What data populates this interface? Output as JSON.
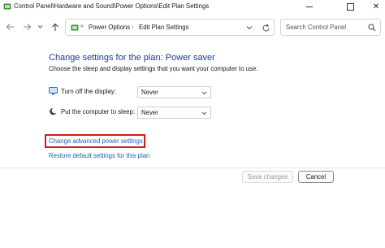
{
  "window": {
    "title": "Control Panel\\Hardware and Sound\\Power Options\\Edit Plan Settings",
    "controls": {
      "minimize_icon": "minimize-icon",
      "maximize_icon": "maximize-icon",
      "close_glyph": "✕"
    }
  },
  "address_bar": {
    "separator": "«",
    "crumbs": [
      "Power Options",
      "Edit Plan Settings"
    ],
    "crumb_separator": "›"
  },
  "search": {
    "placeholder": "Search Control Panel"
  },
  "main": {
    "heading": "Change settings for the plan: Power saver",
    "subtext": "Choose the sleep and display settings that you want your computer to use.",
    "settings": [
      {
        "label": "Turn off the display:",
        "value": "Never",
        "icon": "monitor-icon"
      },
      {
        "label": "Put the computer to sleep:",
        "value": "Never",
        "icon": "moon-icon"
      }
    ],
    "links": {
      "advanced": "Change advanced power settings",
      "restore": "Restore default settings for this plan"
    }
  },
  "buttons": {
    "save": "Save changes",
    "cancel": "Cancel"
  },
  "colors": {
    "heading": "#1e3a8a",
    "link": "#1f5fbf",
    "highlight": "#d11a1a"
  }
}
